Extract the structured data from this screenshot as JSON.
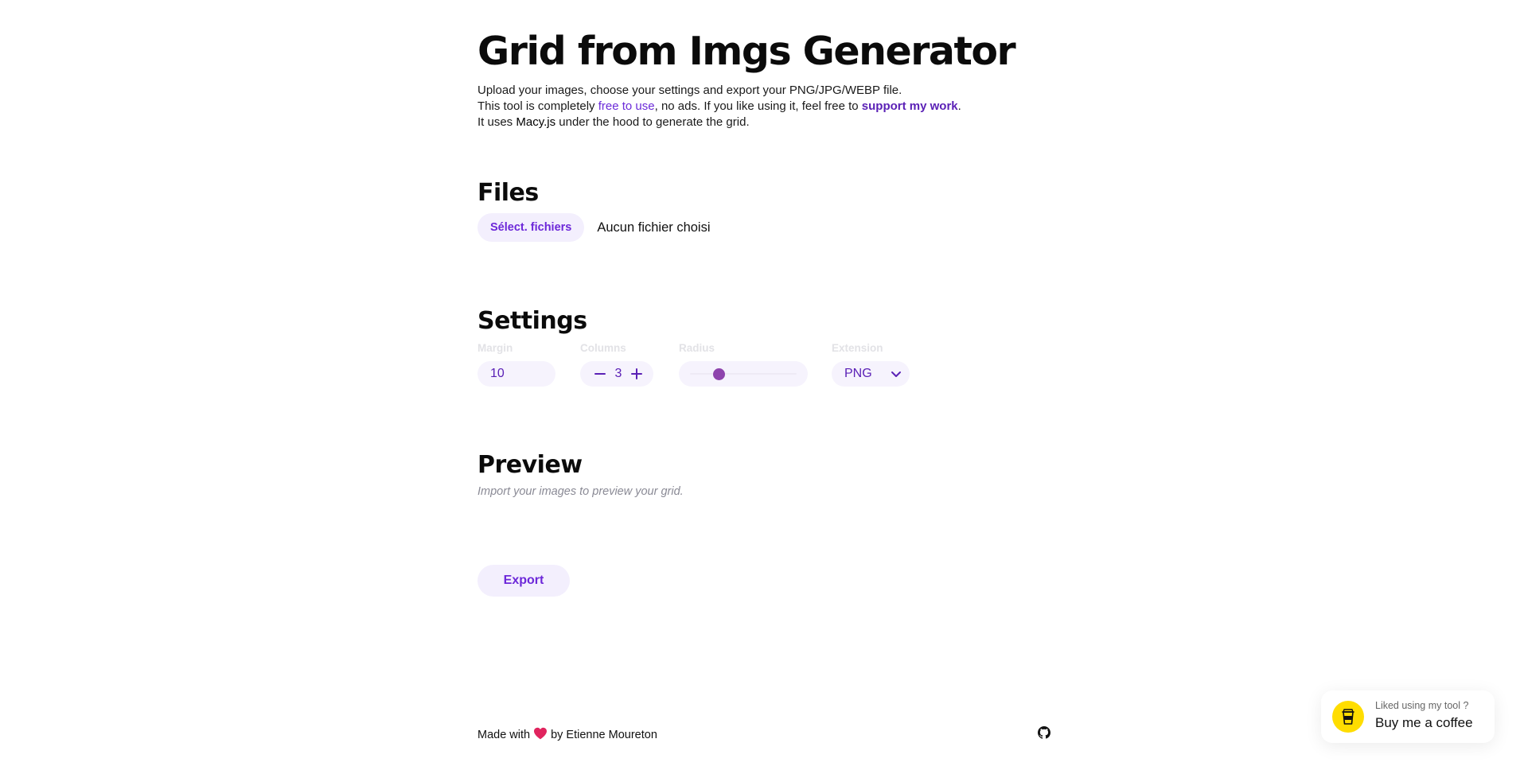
{
  "header": {
    "title": "Grid from Imgs Generator",
    "intro_line1": "Upload your images, choose your settings and export your PNG/JPG/WEBP file.",
    "intro_line2_a": "This tool is completely ",
    "intro_line2_link": "free to use",
    "intro_line2_b": ", no ads. If you like using it, feel free to ",
    "intro_line2_support": "support my work",
    "intro_line2_c": ".",
    "intro_line3_a": "It uses ",
    "intro_line3_lib": "Macy.js",
    "intro_line3_b": " under the hood to generate the grid."
  },
  "files": {
    "heading": "Files",
    "button_label": "Sélect. fichiers",
    "status": "Aucun fichier choisi"
  },
  "settings": {
    "heading": "Settings",
    "margin": {
      "label": "Margin",
      "value": "10"
    },
    "columns": {
      "label": "Columns",
      "value": "3"
    },
    "radius": {
      "label": "Radius",
      "level_fraction": 0.27
    },
    "extension": {
      "label": "Extension",
      "value": "PNG"
    }
  },
  "preview": {
    "heading": "Preview",
    "hint": "Import your images to preview your grid."
  },
  "export": {
    "label": "Export"
  },
  "footer": {
    "made_with": "Made with",
    "by": "by Etienne Moureton"
  },
  "bmc": {
    "small": "Liked using my tool ?",
    "big": "Buy me a coffee"
  },
  "colors": {
    "accent": "#6d28d9",
    "pill_bg": "#f3effd",
    "slider_thumb": "#8e44ad",
    "coffee_yellow": "#ffdd00"
  },
  "icons": {
    "heart": "heart-icon",
    "github": "github-icon",
    "coffee": "coffee-cup-icon",
    "minus": "minus-icon",
    "plus": "plus-icon",
    "chevron": "chevron-down-icon"
  }
}
